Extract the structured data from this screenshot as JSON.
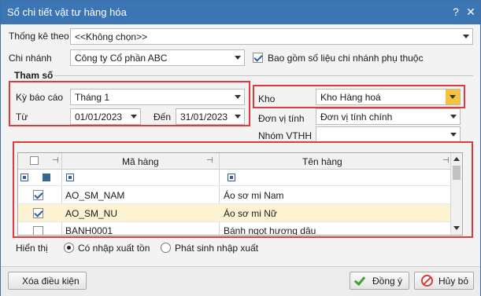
{
  "window": {
    "title": "Sổ chi tiết vật tư hàng hóa",
    "help": "?",
    "close": "✕"
  },
  "thong_ke_theo": {
    "label": "Thống kê theo",
    "value": "<<Không chọn>>"
  },
  "chi_nhanh": {
    "label": "Chi nhánh",
    "value": "Công ty Cổ phần ABC",
    "include_branch_label": "Bao gồm số liệu chi nhánh phụ thuộc",
    "include_branch_checked": true
  },
  "tham_so": {
    "label": "Tham số",
    "ky_bao_cao": {
      "label": "Kỳ báo cáo",
      "value": "Tháng 1"
    },
    "tu": {
      "label": "Từ",
      "value": "01/01/2023"
    },
    "den": {
      "label": "Đến",
      "value": "31/01/2023"
    },
    "kho": {
      "label": "Kho",
      "value": "Kho Hàng hoá"
    },
    "don_vi_tinh": {
      "label": "Đơn vị tính",
      "value": "Đơn vị tính chính"
    },
    "nhom_vthh": {
      "label": "Nhóm VTHH",
      "value": ""
    }
  },
  "grid": {
    "columns": {
      "code": "Mã hàng",
      "name": "Tên hàng"
    },
    "rows": [
      {
        "code": "AO_SM_NAM",
        "name": "Áo sơ mi Nam",
        "checked": true
      },
      {
        "code": "AO_SM_NU",
        "name": "Áo sơ mi Nữ",
        "checked": true
      },
      {
        "code": "BANH0001",
        "name": "Bánh ngọt hương dâu",
        "checked": false
      }
    ]
  },
  "hien_thi": {
    "label": "Hiển thị",
    "option_1": "Có nhập xuất tồn",
    "option_2": "Phát sinh nhập xuất",
    "selected": "option_1"
  },
  "footer": {
    "clear": "Xóa điều kiện",
    "ok": "Đồng ý",
    "cancel": "Hủy bỏ"
  },
  "colors": {
    "titlebar": "#3c75b3",
    "highlight": "#e0393e",
    "selected_row": "#fdf3d3",
    "dropdown_accent": "#f7c33c"
  }
}
